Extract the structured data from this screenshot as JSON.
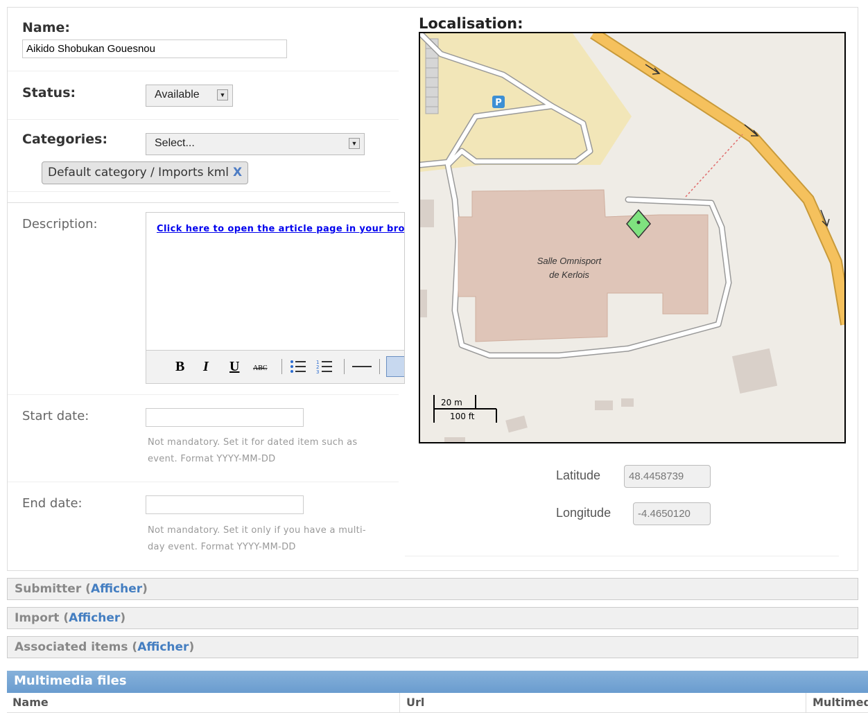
{
  "form": {
    "name_label": "Name:",
    "name_value": "Aikido Shobukan Gouesnou",
    "status_label": "Status:",
    "status_value": "Available",
    "categories_label": "Categories:",
    "categories_placeholder": "Select...",
    "category_tag": "Default category / Imports kml",
    "category_tag_remove": "X",
    "description_label": "Description:",
    "description_link": "Click here to open the article page in your browser",
    "toolbar": {
      "bold": "B",
      "italic": "I",
      "underline": "U",
      "strike": "ABC"
    },
    "start_date_label": "Start date:",
    "start_date_value": "",
    "start_date_help": "Not mandatory. Set it for dated item such as event. Format YYYY-MM-DD",
    "end_date_label": "End date:",
    "end_date_value": "",
    "end_date_help": "Not mandatory. Set it only if you have a multi-day event. Format YYYY-MM-DD"
  },
  "map": {
    "title": "Localisation:",
    "building_label_line1": "Salle Omnisport",
    "building_label_line2": "de Kerlois",
    "parking": "P",
    "scale_metric": "20 m",
    "scale_imperial": "100 ft",
    "latitude_label": "Latitude",
    "latitude_value": "48.4458739",
    "longitude_label": "Longitude",
    "longitude_value": "-4.4650120"
  },
  "sections": [
    {
      "title": "Submitter",
      "action": "Afficher"
    },
    {
      "title": "Import",
      "action": "Afficher"
    },
    {
      "title": "Associated items",
      "action": "Afficher"
    }
  ],
  "multimedia": {
    "title": "Multimedia files",
    "columns": [
      "Name",
      "Url",
      "Multimedia"
    ]
  },
  "colors": {
    "road_major": "#f5c15d",
    "building": "#dfc5b8",
    "parking_area": "#f2e6b8",
    "marker": "#7fe27f",
    "header_blue": "#79a8d6",
    "link_blue": "#447ec1"
  }
}
